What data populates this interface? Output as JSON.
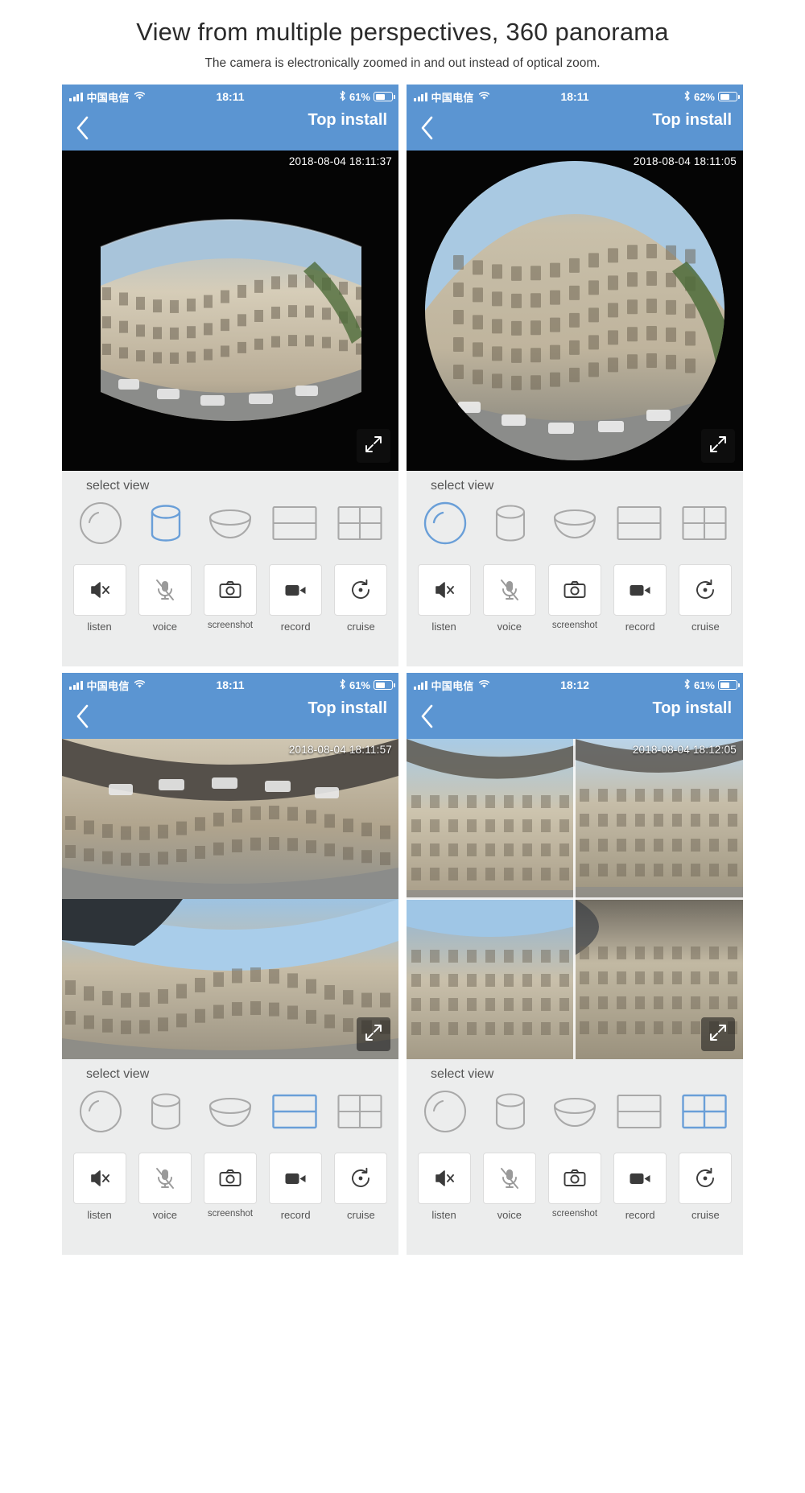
{
  "header": {
    "title": "View from multiple perspectives, 360 panorama",
    "subtitle": "The camera is electronically zoomed in and out instead of optical zoom."
  },
  "common": {
    "carrier": "中国电信",
    "nav_title": "Top install",
    "select_view_label": "select view",
    "back_icon": "back-chevron-icon",
    "fullscreen_icon": "fullscreen-expand-icon",
    "wifi_icon": "wifi-icon",
    "bluetooth_icon": "bluetooth-icon",
    "signal_icon": "cellular-signal-icon",
    "battery_icon": "battery-icon",
    "accent_blue": "#5b95d2",
    "panel_bg": "#eceded",
    "icon_grey": "#a9a9a9",
    "selected_blue": "#6a9fd8",
    "view_modes": [
      {
        "id": "sphere",
        "icon": "sphere-view-icon"
      },
      {
        "id": "cylinder",
        "icon": "cylinder-view-icon"
      },
      {
        "id": "bowl",
        "icon": "bowl-view-icon"
      },
      {
        "id": "split2",
        "icon": "two-split-view-icon"
      },
      {
        "id": "split4",
        "icon": "four-split-view-icon"
      }
    ],
    "controls": [
      {
        "id": "listen",
        "label": "listen",
        "icon": "speaker-muted-icon"
      },
      {
        "id": "voice",
        "label": "voice",
        "icon": "microphone-muted-icon"
      },
      {
        "id": "screenshot",
        "label": "screenshot",
        "icon": "camera-icon"
      },
      {
        "id": "record",
        "label": "record",
        "icon": "video-camera-icon"
      },
      {
        "id": "cruise",
        "label": "cruise",
        "icon": "rotate-cruise-icon"
      }
    ]
  },
  "panels": [
    {
      "id": "panel-cylinder",
      "time": "18:11",
      "battery": "61%",
      "battery_level": 61,
      "timestamp": "2018-08-04  18:11:37",
      "selected_view": "cylinder"
    },
    {
      "id": "panel-sphere",
      "time": "18:11",
      "battery": "62%",
      "battery_level": 62,
      "timestamp": "2018-08-04  18:11:05",
      "selected_view": "sphere"
    },
    {
      "id": "panel-split2",
      "time": "18:11",
      "battery": "61%",
      "battery_level": 61,
      "timestamp": "2018-08-04  18:11:57",
      "selected_view": "split2"
    },
    {
      "id": "panel-split4",
      "time": "18:12",
      "battery": "61%",
      "battery_level": 61,
      "timestamp": "2018-08-04  18:12:05",
      "selected_view": "split4"
    }
  ]
}
